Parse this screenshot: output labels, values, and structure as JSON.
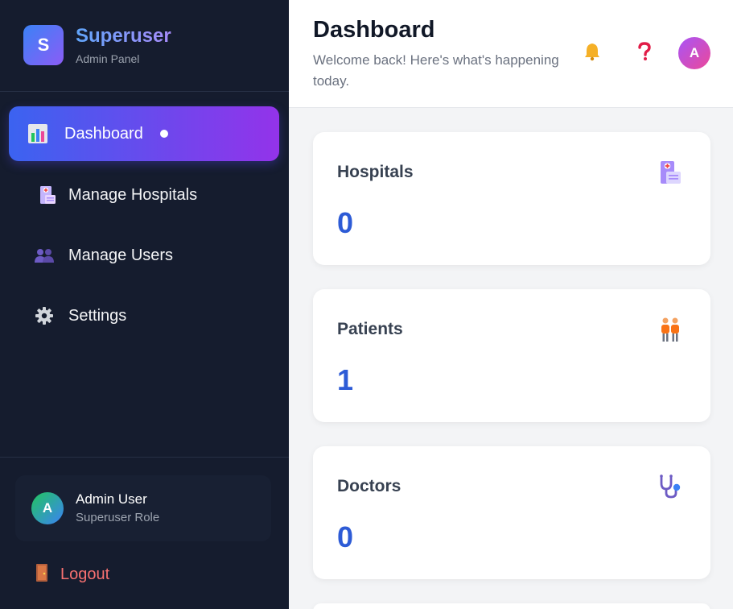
{
  "brand": {
    "logo_letter": "S",
    "title": "Superuser",
    "subtitle": "Admin Panel"
  },
  "sidebar": {
    "items": [
      {
        "label": "Dashboard",
        "icon": "bar-chart-icon",
        "active": true
      },
      {
        "label": "Manage Hospitals",
        "icon": "hospital-icon",
        "active": false
      },
      {
        "label": "Manage Users",
        "icon": "users-icon",
        "active": false
      },
      {
        "label": "Settings",
        "icon": "gear-icon",
        "active": false
      }
    ],
    "user": {
      "avatar_letter": "A",
      "name": "Admin User",
      "role": "Superuser Role"
    },
    "logout_label": "Logout"
  },
  "header": {
    "title": "Dashboard",
    "subtitle": "Welcome back! Here's what's happening today.",
    "avatar_letter": "A"
  },
  "stats": [
    {
      "label": "Hospitals",
      "value": "0",
      "icon": "hospital-icon"
    },
    {
      "label": "Patients",
      "value": "1",
      "icon": "people-icon"
    },
    {
      "label": "Doctors",
      "value": "0",
      "icon": "stethoscope-icon"
    }
  ],
  "colors": {
    "accent_start": "#3b63f0",
    "accent_end": "#9333ea",
    "stat_value": "#2d5bd6",
    "logout": "#f87171",
    "sidebar_bg": "#151c2e"
  }
}
